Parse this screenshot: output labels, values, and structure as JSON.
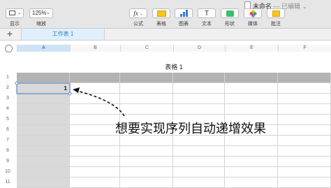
{
  "window": {
    "doc_title": "未命名",
    "doc_status": "— 已编辑 ⌄"
  },
  "toolbar": {
    "view_label": "显示",
    "zoom_value": "125%",
    "zoom_label": "缩放",
    "formula_icon_text": "fx",
    "formula_label": "公式",
    "table_label": "表格",
    "chart_label": "图表",
    "text_icon_text": "T",
    "text_label": "文本",
    "shape_label": "形状",
    "media_label": "媒体",
    "comment_label": "批注"
  },
  "sheet_tabs": {
    "add_label": "+",
    "active_tab": "工作表 1"
  },
  "grid": {
    "columns": [
      "A",
      "B",
      "C",
      "D",
      "E",
      "F"
    ],
    "rows": [
      "1",
      "2",
      "3",
      "4",
      "5",
      "6",
      "7",
      "8",
      "9",
      "10",
      "11"
    ],
    "table_title": "表格 1",
    "selected_cell_value": "1"
  },
  "annotation": {
    "text": "想要实现序列自动递增效果"
  },
  "colors": {
    "header_row": "#b3b3b3",
    "header_column": "#d9d9d9",
    "selection": "#5b8ccc",
    "tab_text": "#2d7fd1"
  }
}
